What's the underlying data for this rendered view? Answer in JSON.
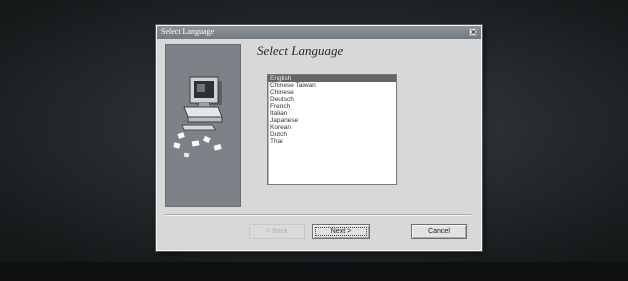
{
  "window": {
    "title": "Select Language",
    "close_icon": "close-icon"
  },
  "main": {
    "heading": "Select Language",
    "illustration_icon": "computer-icon",
    "languages": [
      "English",
      "Chinese Taiwan",
      "Chinese",
      "Deutsch",
      "French",
      "Italian",
      "Japanese",
      "Korean",
      "Dutch",
      "Thai"
    ],
    "selected_index": 0
  },
  "buttons": {
    "back": "< Back",
    "next": "Next >",
    "cancel": "Cancel"
  },
  "colors": {
    "selection": "#616669",
    "side_panel": "#7d8288",
    "titlebar": "#7f878d"
  }
}
